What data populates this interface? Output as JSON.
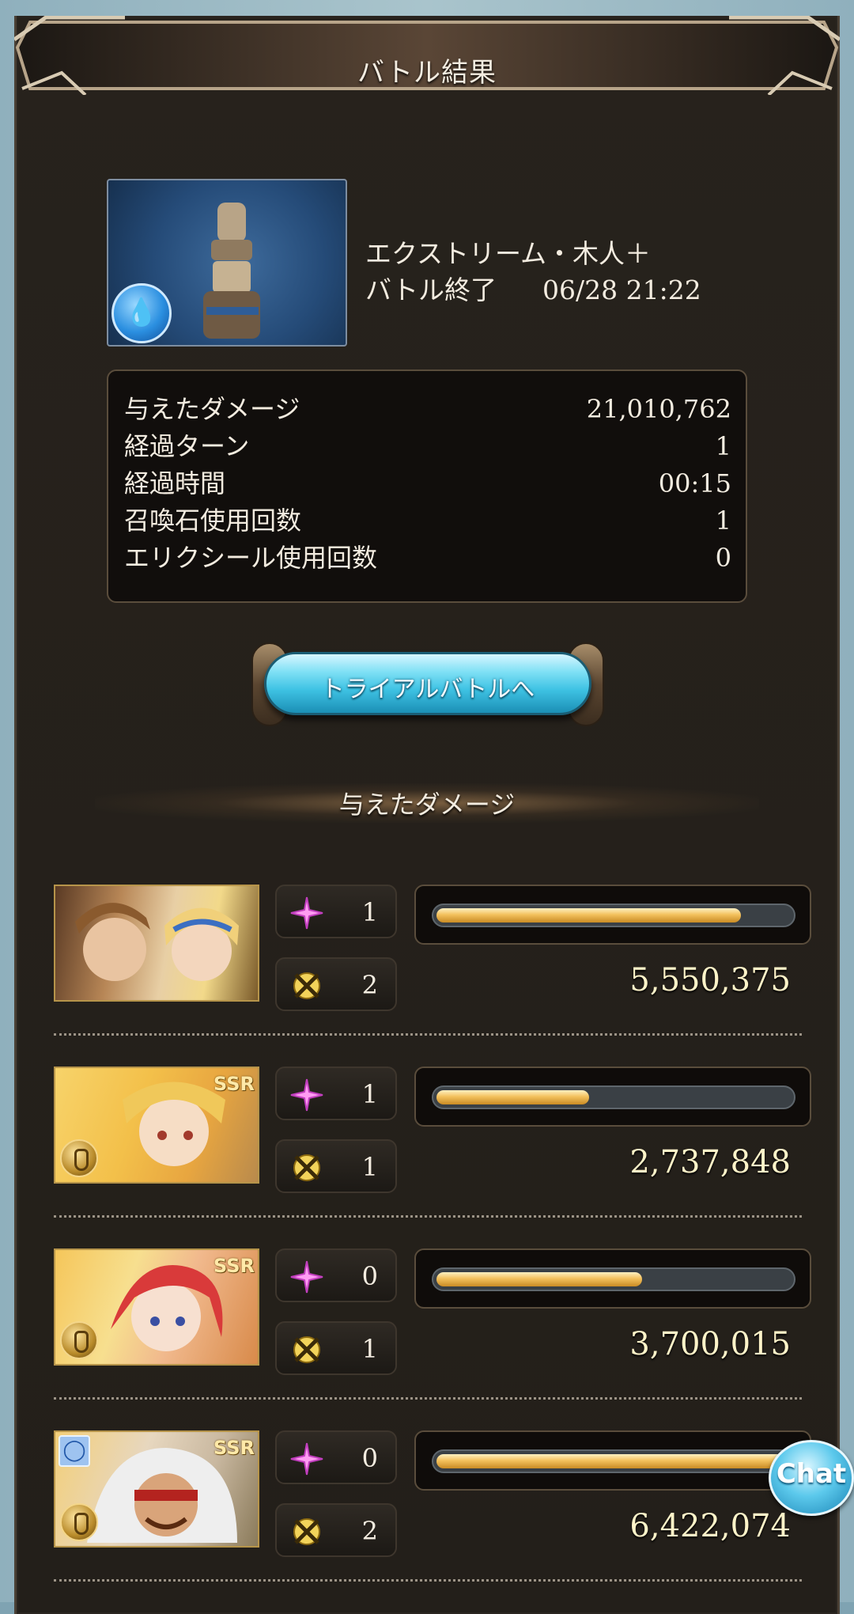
{
  "header": {
    "title": "バトル結果"
  },
  "quest": {
    "name": "エクストリーム・木人＋",
    "status": "バトル終了",
    "datetime": "06/28 21:22",
    "element_icon": "water-element-icon"
  },
  "stats": [
    {
      "label": "与えたダメージ",
      "value": "21,010,762"
    },
    {
      "label": "経過ターン",
      "value": "1"
    },
    {
      "label": "経過時間",
      "value": "00:15"
    },
    {
      "label": "召喚石使用回数",
      "value": "1"
    },
    {
      "label": "エリクシール使用回数",
      "value": "0"
    }
  ],
  "trial_button": {
    "label": "トライアルバトルへ"
  },
  "damage_section": {
    "title": "与えたダメージ"
  },
  "characters": [
    {
      "rarity": "",
      "skill_count": "1",
      "ougi_count": "2",
      "damage": "5,550,375",
      "share": 0.86
    },
    {
      "rarity": "SSR",
      "skill_count": "1",
      "ougi_count": "1",
      "damage": "2,737,848",
      "share": 0.43
    },
    {
      "rarity": "SSR",
      "skill_count": "0",
      "ougi_count": "1",
      "damage": "3,700,015",
      "share": 0.58
    },
    {
      "rarity": "SSR",
      "skill_count": "0",
      "ougi_count": "2",
      "damage": "6,422,074",
      "share": 1.0
    }
  ],
  "chat_button": {
    "label": "Chat"
  },
  "colors": {
    "panel_bg": "#27221c",
    "gold_text": "#fff4c9",
    "bar_fill": "#f3c15d",
    "button_cyan": "#3fc3e4"
  }
}
